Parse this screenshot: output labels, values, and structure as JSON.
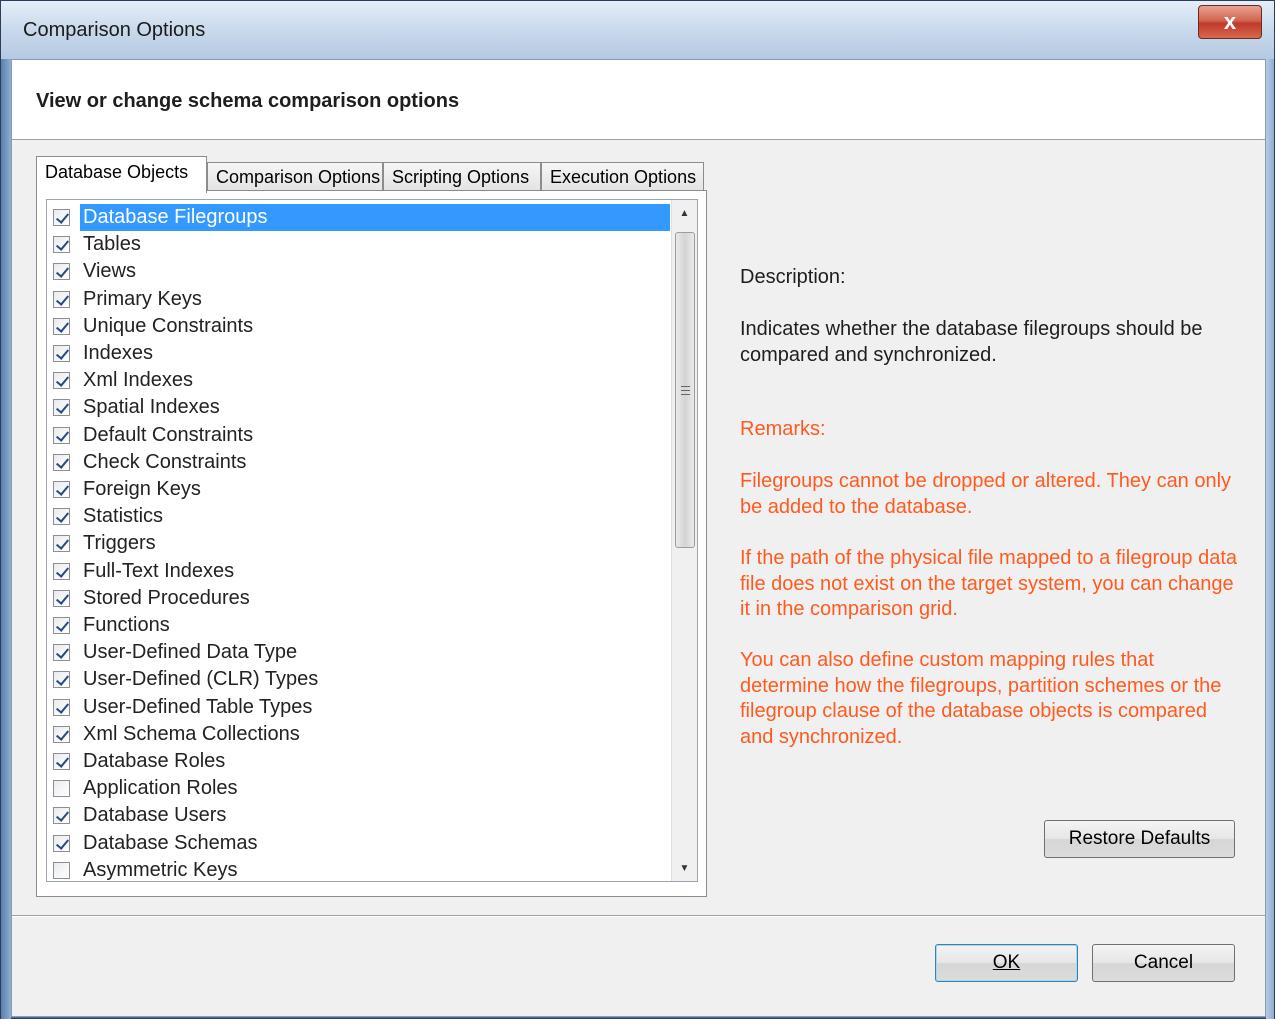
{
  "window": {
    "title": "Comparison Options",
    "close_label": "x"
  },
  "header": {
    "text": "View or change schema comparison options"
  },
  "tabs": [
    {
      "label": "Database Objects",
      "active": true
    },
    {
      "label": "Comparison Options",
      "active": false
    },
    {
      "label": "Scripting Options",
      "active": false
    },
    {
      "label": "Execution Options",
      "active": false
    }
  ],
  "object_list": {
    "items": [
      {
        "label": "Database Filegroups",
        "checked": true,
        "selected": true
      },
      {
        "label": "Tables",
        "checked": true
      },
      {
        "label": "Views",
        "checked": true
      },
      {
        "label": "Primary Keys",
        "checked": true
      },
      {
        "label": "Unique Constraints",
        "checked": true
      },
      {
        "label": "Indexes",
        "checked": true
      },
      {
        "label": "Xml Indexes",
        "checked": true
      },
      {
        "label": "Spatial Indexes",
        "checked": true
      },
      {
        "label": "Default Constraints",
        "checked": true
      },
      {
        "label": "Check Constraints",
        "checked": true
      },
      {
        "label": "Foreign Keys",
        "checked": true
      },
      {
        "label": "Statistics",
        "checked": true
      },
      {
        "label": "Triggers",
        "checked": true
      },
      {
        "label": "Full-Text Indexes",
        "checked": true
      },
      {
        "label": "Stored Procedures",
        "checked": true
      },
      {
        "label": "Functions",
        "checked": true
      },
      {
        "label": "User-Defined Data Type",
        "checked": true
      },
      {
        "label": "User-Defined (CLR) Types",
        "checked": true
      },
      {
        "label": "User-Defined Table Types",
        "checked": true
      },
      {
        "label": "Xml Schema Collections",
        "checked": true
      },
      {
        "label": "Database Roles",
        "checked": true
      },
      {
        "label": "Application Roles",
        "checked": false
      },
      {
        "label": "Database Users",
        "checked": true
      },
      {
        "label": "Database Schemas",
        "checked": true
      },
      {
        "label": "Asymmetric Keys",
        "checked": false
      }
    ],
    "scroll_up_glyph": "▲",
    "scroll_down_glyph": "▼"
  },
  "description": {
    "label": "Description:",
    "text": "Indicates whether the database filegroups should be compared and synchronized."
  },
  "remarks": {
    "label": "Remarks:",
    "paragraphs": [
      "Filegroups cannot be dropped or altered. They can only be added to the database.",
      "If the path of the physical file mapped to a filegroup data file does not exist on the target system, you can change it in the comparison grid.",
      "You can also define custom mapping rules that determine how the filegroups, partition schemes or the filegroup clause of the database objects is compared and synchronized."
    ]
  },
  "buttons": {
    "restore_defaults": "Restore Defaults",
    "ok": "OK",
    "cancel": "Cancel"
  }
}
